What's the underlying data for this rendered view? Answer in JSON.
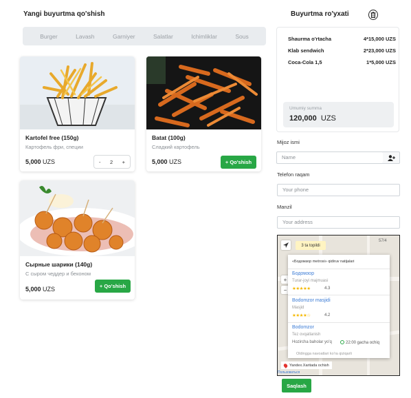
{
  "header": {
    "left_title": "Yangi buyurtma qo'shish",
    "right_title": "Buyurtma ro'yxati"
  },
  "tabs": [
    "Burger",
    "Lavash",
    "Garniyer",
    "Salatlar",
    "Ichimliklar",
    "Sous"
  ],
  "products": [
    {
      "name": "Kartofel free (150g)",
      "description": "Картофель фри, специи",
      "price": "5,000",
      "currency": "UZS",
      "quantity": "2"
    },
    {
      "name": "Batat (100g)",
      "description": "Сладкий картофель",
      "price": "5,000",
      "currency": "UZS",
      "button": "+ Qo'shish"
    },
    {
      "name": "Сырные шарики (140g)",
      "description": "С сыром чеддер и беконом",
      "price": "5,000",
      "currency": "UZS",
      "button": "+ Qo'shish"
    }
  ],
  "stepper": {
    "minus": "-",
    "plus": "+"
  },
  "order": {
    "lines": [
      {
        "name": "Shaurma o'rtacha",
        "qty": "4*15,000 UZS"
      },
      {
        "name": "Klab sendwich",
        "qty": "2*23,000 UZS"
      },
      {
        "name": "Coca-Cola 1,5",
        "qty": "1*5,000 UZS"
      }
    ],
    "total_label": "Umumiy summa",
    "total_value": "120,000",
    "total_currency": "UZS"
  },
  "form": {
    "name_label": "Mijoz ismi",
    "name_placeholder": "Name",
    "phone_label": "Telefon raqam",
    "phone_placeholder": "Your phone",
    "address_label": "Manzil",
    "address_placeholder": "Your address"
  },
  "map": {
    "found_badge": "3 ta topildi",
    "query": "«Бодомзор metrosi» qidiruv natijalari",
    "street_number": "57/4",
    "results": [
      {
        "title": "Бодомзор",
        "subtitle": "Turar-joyi majmuasi",
        "rating": "4.3",
        "stars": "★★★★★"
      },
      {
        "title": "Bodomzor masjidi",
        "subtitle": "Masjid",
        "rating": "4.2",
        "stars": "★★★★☆"
      },
      {
        "title": "Bodomzor",
        "subtitle": "Tez ovqatlanish",
        "note": "Hozircha baholar yo'q",
        "hours": "22:00 gacha ochiq"
      }
    ],
    "footer_text": "Oldingga navoatlari ko'ra qiziqarli",
    "credit": "Yandex.Xaritada ochish",
    "brand": "Пользоваться"
  },
  "save_label": "Saqlash"
}
